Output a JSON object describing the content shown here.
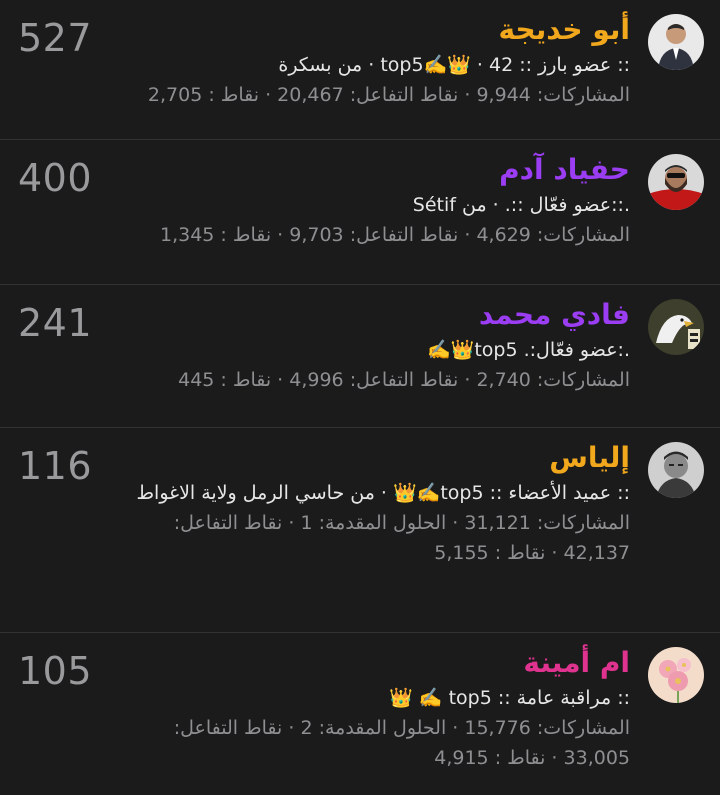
{
  "members": [
    {
      "score": "527",
      "name": "أبو خديجة",
      "name_color": "#f2a81d",
      "rank_line": ":: عضو بارز :: top5✍️👑 · 42 · من بسكرة",
      "stats_line": "المشاركات: 9,944 · نقاط التفاعل: 20,467 · نقاط : 2,705",
      "avatar_icon": "man-in-suit-avatar"
    },
    {
      "score": "400",
      "name": "حفياد آدم",
      "name_color": "#9b3df2",
      "rank_line": ".::عضو فعّال ::. · من Sétif",
      "stats_line": "المشاركات: 4,629 · نقاط التفاعل: 9,703 · نقاط : 1,345",
      "avatar_icon": "bearded-man-avatar"
    },
    {
      "score": "241",
      "name": "فادي محمد",
      "name_color": "#9b3df2",
      "rank_line": ".:عضو فعّال:. top5👑✍️",
      "stats_line": "المشاركات: 2,740 · نقاط التفاعل: 4,996 · نقاط : 445",
      "avatar_icon": "eagle-avatar"
    },
    {
      "score": "116",
      "name": "إلياس",
      "name_color": "#f2a81d",
      "rank_line": ":: عميد الأعضاء :: top5✍️👑 · من حاسي الرمل ولاية الاغواط",
      "stats_line": "المشاركات: 31,121 · الحلول المقدمة: 1 · نقاط التفاعل: 42,137 · نقاط : 5,155",
      "avatar_icon": "man-portrait-avatar"
    },
    {
      "score": "105",
      "name": "ام أمينة",
      "name_color": "#e0338f",
      "rank_line": ":: مراقبة عامة :: top5 ✍️ 👑",
      "stats_line": "المشاركات: 15,776 · الحلول المقدمة: 2 · نقاط التفاعل: 33,005 · نقاط : 4,915",
      "avatar_icon": "flower-avatar"
    }
  ]
}
